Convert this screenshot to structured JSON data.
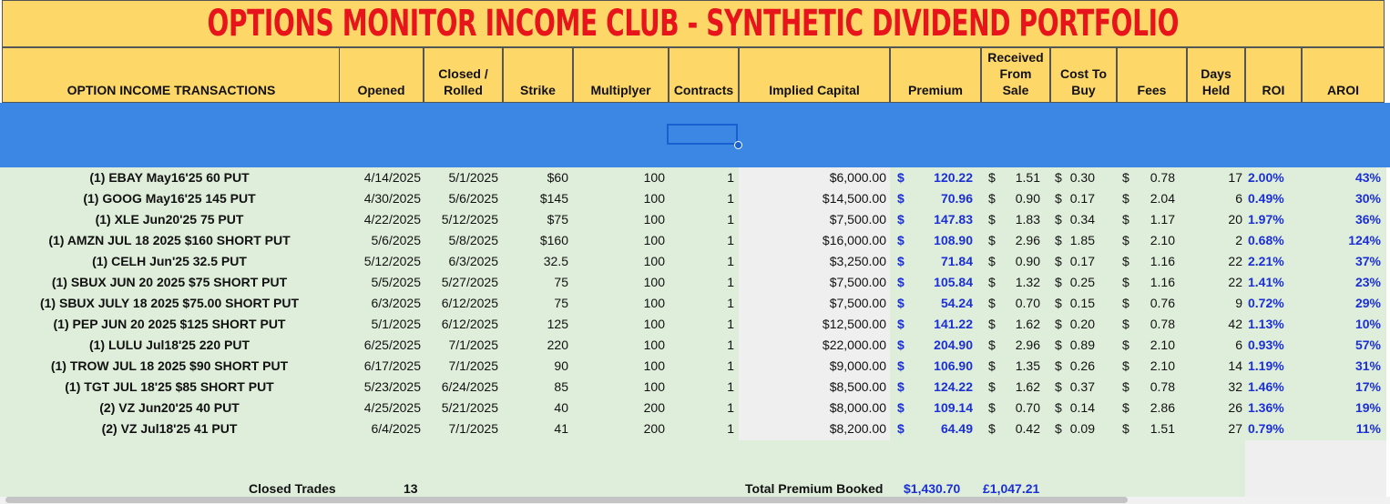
{
  "title": "OPTIONS MONITOR INCOME CLUB - SYNTHETIC DIVIDEND PORTFOLIO",
  "columns": [
    {
      "label": "OPTION INCOME TRANSACTIONS"
    },
    {
      "label": "Opened"
    },
    {
      "label": "Closed /\nRolled"
    },
    {
      "label": "Strike"
    },
    {
      "label": "Multiplyer"
    },
    {
      "label": "Contracts"
    },
    {
      "label": "Implied Capital"
    },
    {
      "label": "Premium"
    },
    {
      "label": "Received\nFrom\nSale"
    },
    {
      "label": "Cost To\nBuy"
    },
    {
      "label": "Fees"
    },
    {
      "label": "Days\nHeld"
    },
    {
      "label": "ROI"
    },
    {
      "label": "AROI"
    }
  ],
  "currency_symbol": "$",
  "rows": [
    {
      "name": "(1) EBAY May16'25 60 PUT",
      "opened": "4/14/2025",
      "closed": "5/1/2025",
      "strike": "$60",
      "mult": "100",
      "contracts": "1",
      "capital": "$6,000.00",
      "premium": "120.22",
      "received": "1.51",
      "cost": "0.30",
      "fees": "0.78",
      "days": "17",
      "roi": "2.00%",
      "aroi": "43%"
    },
    {
      "name": "(1) GOOG May16'25 145 PUT",
      "opened": "4/30/2025",
      "closed": "5/6/2025",
      "strike": "$145",
      "mult": "100",
      "contracts": "1",
      "capital": "$14,500.00",
      "premium": "70.96",
      "received": "0.90",
      "cost": "0.17",
      "fees": "2.04",
      "days": "6",
      "roi": "0.49%",
      "aroi": "30%"
    },
    {
      "name": "(1) XLE Jun20'25 75 PUT",
      "opened": "4/22/2025",
      "closed": "5/12/2025",
      "strike": "$75",
      "mult": "100",
      "contracts": "1",
      "capital": "$7,500.00",
      "premium": "147.83",
      "received": "1.83",
      "cost": "0.34",
      "fees": "1.17",
      "days": "20",
      "roi": "1.97%",
      "aroi": "36%"
    },
    {
      "name": "(1) AMZN JUL 18 2025 $160 SHORT PUT",
      "opened": "5/6/2025",
      "closed": "5/8/2025",
      "strike": "$160",
      "mult": "100",
      "contracts": "1",
      "capital": "$16,000.00",
      "premium": "108.90",
      "received": "2.96",
      "cost": "1.85",
      "fees": "2.10",
      "days": "2",
      "roi": "0.68%",
      "aroi": "124%"
    },
    {
      "name": "(1) CELH Jun'25 32.5 PUT",
      "opened": "5/12/2025",
      "closed": "6/3/2025",
      "strike": "32.5",
      "mult": "100",
      "contracts": "1",
      "capital": "$3,250.00",
      "premium": "71.84",
      "received": "0.90",
      "cost": "0.17",
      "fees": "1.16",
      "days": "22",
      "roi": "2.21%",
      "aroi": "37%"
    },
    {
      "name": "(1) SBUX JUN 20 2025 $75 SHORT PUT",
      "opened": "5/5/2025",
      "closed": "5/27/2025",
      "strike": "75",
      "mult": "100",
      "contracts": "1",
      "capital": "$7,500.00",
      "premium": "105.84",
      "received": "1.32",
      "cost": "0.25",
      "fees": "1.16",
      "days": "22",
      "roi": "1.41%",
      "aroi": "23%"
    },
    {
      "name": "(1) SBUX JULY 18 2025 $75.00 SHORT PUT",
      "opened": "6/3/2025",
      "closed": "6/12/2025",
      "strike": "75",
      "mult": "100",
      "contracts": "1",
      "capital": "$7,500.00",
      "premium": "54.24",
      "received": "0.70",
      "cost": "0.15",
      "fees": "0.76",
      "days": "9",
      "roi": "0.72%",
      "aroi": "29%"
    },
    {
      "name": "(1) PEP JUN 20 2025 $125 SHORT PUT",
      "opened": "5/1/2025",
      "closed": "6/12/2025",
      "strike": "125",
      "mult": "100",
      "contracts": "1",
      "capital": "$12,500.00",
      "premium": "141.22",
      "received": "1.62",
      "cost": "0.20",
      "fees": "0.78",
      "days": "42",
      "roi": "1.13%",
      "aroi": "10%"
    },
    {
      "name": "(1) LULU Jul18'25 220 PUT",
      "opened": "6/25/2025",
      "closed": "7/1/2025",
      "strike": "220",
      "mult": "100",
      "contracts": "1",
      "capital": "$22,000.00",
      "premium": "204.90",
      "received": "2.96",
      "cost": "0.89",
      "fees": "2.10",
      "days": "6",
      "roi": "0.93%",
      "aroi": "57%"
    },
    {
      "name": "(1) TROW JUL 18 2025 $90 SHORT PUT",
      "opened": "6/17/2025",
      "closed": "7/1/2025",
      "strike": "90",
      "mult": "100",
      "contracts": "1",
      "capital": "$9,000.00",
      "premium": "106.90",
      "received": "1.35",
      "cost": "0.26",
      "fees": "2.10",
      "days": "14",
      "roi": "1.19%",
      "aroi": "31%"
    },
    {
      "name": "(1) TGT JUL 18'25 $85 SHORT PUT",
      "opened": "5/23/2025",
      "closed": "6/24/2025",
      "strike": "85",
      "mult": "100",
      "contracts": "1",
      "capital": "$8,500.00",
      "premium": "124.22",
      "received": "1.62",
      "cost": "0.37",
      "fees": "0.78",
      "days": "32",
      "roi": "1.46%",
      "aroi": "17%"
    },
    {
      "name": "(2) VZ Jun20'25 40 PUT",
      "opened": "4/25/2025",
      "closed": "5/21/2025",
      "strike": "40",
      "mult": "200",
      "contracts": "1",
      "capital": "$8,000.00",
      "premium": "109.14",
      "received": "0.70",
      "cost": "0.14",
      "fees": "2.86",
      "days": "26",
      "roi": "1.36%",
      "aroi": "19%"
    },
    {
      "name": "(2) VZ Jul18'25 41 PUT",
      "opened": "6/4/2025",
      "closed": "7/1/2025",
      "strike": "41",
      "mult": "200",
      "contracts": "1",
      "capital": "$8,200.00",
      "premium": "64.49",
      "received": "0.42",
      "cost": "0.09",
      "fees": "1.51",
      "days": "27",
      "roi": "0.79%",
      "aroi": "11%"
    }
  ],
  "footer": {
    "closed_trades_label": "Closed Trades",
    "closed_trades_value": "13",
    "total_premium_label": "Total Premium Booked",
    "total_premium_usd": "$1,430.70",
    "total_premium_gbp": "£1,047.21"
  },
  "colors": {
    "title_bg": "#fed769",
    "title_text": "#e8141c",
    "header_band": "#3d87e4",
    "row_bg": "#dfeedb",
    "accent_blue": "#1b2fd6"
  }
}
